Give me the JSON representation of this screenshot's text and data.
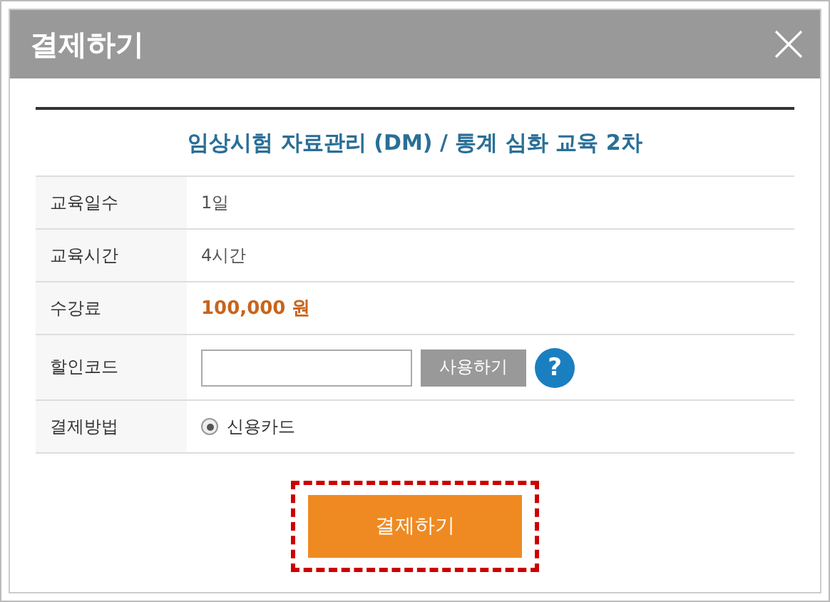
{
  "dialog": {
    "title": "결제하기"
  },
  "course_title": "임상시험 자료관리 (DM) / 통계 심화 교육 2차",
  "rows": [
    {
      "kind": "text",
      "label": "교육일수",
      "value": "1일"
    },
    {
      "kind": "text",
      "label": "교육시간",
      "value": "4시간"
    },
    {
      "kind": "price",
      "label": "수강료",
      "value": "100,000 원"
    },
    {
      "kind": "coupon",
      "label": "할인코드",
      "button": "사용하기",
      "help": "?"
    },
    {
      "kind": "radio",
      "label": "결제방법",
      "options": [
        {
          "label": "신용카드",
          "selected": true
        }
      ]
    }
  ],
  "submit": {
    "label": "결제하기",
    "highlighted": true
  }
}
